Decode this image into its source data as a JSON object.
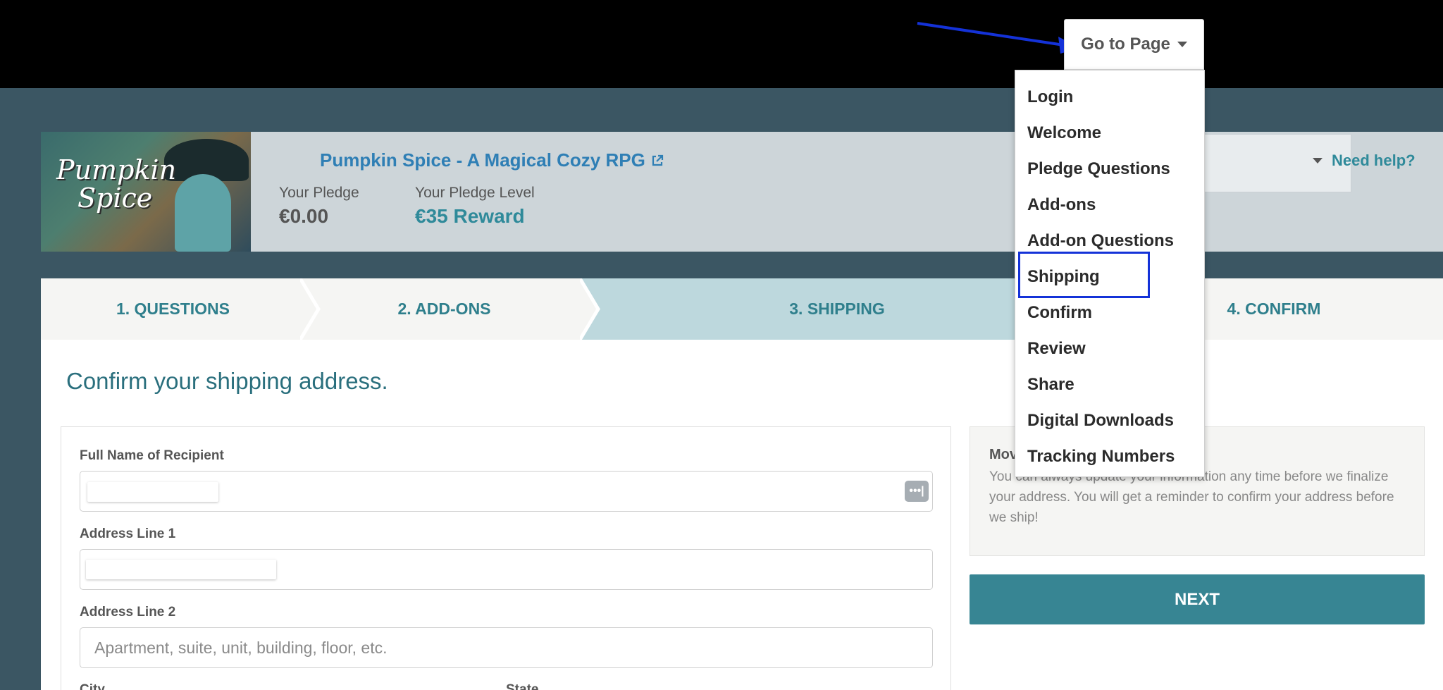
{
  "goto": {
    "label": "Go to Page"
  },
  "dropdown": {
    "items": [
      "Login",
      "Welcome",
      "Pledge Questions",
      "Add-ons",
      "Add-on Questions",
      "Shipping",
      "Confirm",
      "Review",
      "Share",
      "Digital Downloads",
      "Tracking Numbers"
    ],
    "highlighted": "Shipping"
  },
  "project": {
    "logo_line1": "Pumpkin",
    "logo_line2": "Spice",
    "title": "Pumpkin Spice - A Magical Cozy RPG",
    "pledge_label": "Your Pledge",
    "pledge_value": "€0.00",
    "level_label": "Your Pledge Level",
    "level_value": "€35 Reward",
    "need_help": "Need help?"
  },
  "steps": [
    "1. QUESTIONS",
    "2. ADD-ONS",
    "3. SHIPPING",
    "4. CONFIRM"
  ],
  "form": {
    "heading": "Confirm your shipping address.",
    "full_name_label": "Full Name of Recipient",
    "address1_label": "Address Line 1",
    "address2_label": "Address Line 2",
    "address2_placeholder": "Apartment, suite, unit, building, floor, etc.",
    "city_label": "City",
    "state_label": "State"
  },
  "info": {
    "title": "Mov",
    "text": "You can always update your information any time before we finalize your address. You will get a reminder to confirm your address before we ship!"
  },
  "next_button": "NEXT",
  "colors": {
    "accent": "#378593",
    "link": "#2f7fb5",
    "annotation": "#1432d8"
  }
}
